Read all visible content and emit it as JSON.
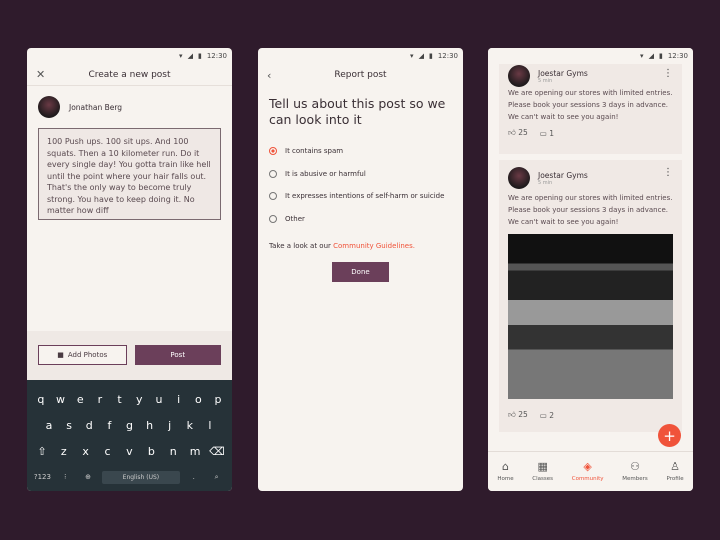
{
  "status": {
    "time": "12:30"
  },
  "create": {
    "title": "Create a new post",
    "user": "Jonathan Berg",
    "text": "100 Push ups. 100 sit ups. And 100 squats. Then a 10 kilometer run. Do it every single day! You gotta train like hell until the point where your hair falls out. That's the only way to become truly strong. You have to keep doing it. No matter how diff",
    "add_photos": "Add Photos",
    "post": "Post",
    "keyboard": {
      "row1": [
        "q",
        "w",
        "e",
        "r",
        "t",
        "y",
        "u",
        "i",
        "o",
        "p"
      ],
      "row2": [
        "a",
        "s",
        "d",
        "f",
        "g",
        "h",
        "j",
        "k",
        "l"
      ],
      "row3": [
        "z",
        "x",
        "c",
        "v",
        "b",
        "n",
        "m"
      ],
      "sym": "?123",
      "space": "English (US)",
      "period": "."
    }
  },
  "report": {
    "title": "Report post",
    "heading": "Tell us about this post so we can look into it",
    "options": [
      {
        "label": "It contains spam",
        "selected": true
      },
      {
        "label": "It is abusive or harmful",
        "selected": false
      },
      {
        "label": "It expresses intentions of self-harm or suicide",
        "selected": false
      },
      {
        "label": "Other",
        "selected": false
      }
    ],
    "guide_prefix": "Take a look at our ",
    "guide_link": "Community Guidelines.",
    "done": "Done"
  },
  "feed": {
    "posts": [
      {
        "name": "Joestar Gyms",
        "time": "5 min",
        "text": "We are opening our stores with limited entries. Please book your sessions 3 days in advance. We can't wait to see you again!",
        "likes": "25",
        "comments": "1"
      },
      {
        "name": "Joestar Gyms",
        "time": "5 min",
        "text": "We are opening our stores with limited entries. Please book your sessions 3 days in advance. We can't wait to see you again!",
        "likes": "25",
        "comments": "2"
      }
    ],
    "nav": [
      {
        "label": "Home",
        "icon": "home-icon"
      },
      {
        "label": "Classes",
        "icon": "calendar-icon"
      },
      {
        "label": "Community",
        "icon": "layers-icon",
        "active": true
      },
      {
        "label": "Members",
        "icon": "members-icon"
      },
      {
        "label": "Profile",
        "icon": "profile-icon"
      }
    ]
  },
  "colors": {
    "accent": "#f0533a",
    "primary": "#6b3f5a",
    "background": "#2f1b2c"
  }
}
